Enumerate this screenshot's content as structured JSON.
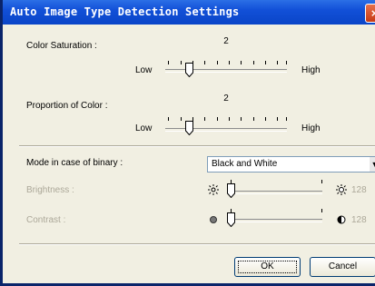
{
  "window": {
    "title": "Auto Image Type Detection Settings",
    "close_icon": "×"
  },
  "color_saturation": {
    "label": "Color Saturation :",
    "value": "2",
    "low_label": "Low",
    "high_label": "High",
    "level": 2,
    "max": 10
  },
  "proportion_of_color": {
    "label": "Proportion of Color :",
    "value": "2",
    "low_label": "Low",
    "high_label": "High",
    "level": 2,
    "max": 10
  },
  "binary_mode": {
    "label": "Mode in case of binary :",
    "selected": "Black and White",
    "arrow": "▼"
  },
  "brightness": {
    "label": "Brightness :",
    "value": "128",
    "low_icon": "sun-dim-icon",
    "high_icon": "sun-bright-icon",
    "level": 0
  },
  "contrast": {
    "label": "Contrast :",
    "value": "128",
    "low_icon": "circle-icon",
    "high_icon": "half-circle-icon",
    "level": 0
  },
  "buttons": {
    "ok": "OK",
    "cancel": "Cancel"
  }
}
